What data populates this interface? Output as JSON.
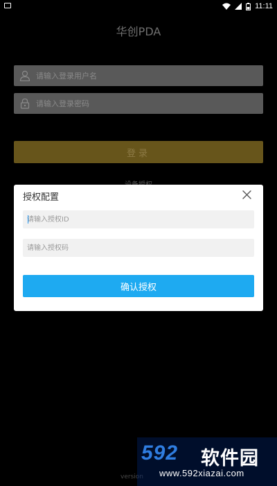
{
  "status_bar": {
    "time": "11:11",
    "icons": [
      "keyboard-icon",
      "wifi-icon",
      "signal-icon",
      "battery-icon"
    ]
  },
  "app": {
    "title": "华创PDA",
    "username": {
      "placeholder": "请输入登录用户名",
      "icon": "user-icon"
    },
    "password": {
      "placeholder": "请输入登录密码",
      "icon": "lock-icon"
    },
    "login_label": "登录",
    "device_auth_label": "设备授权",
    "version_label": "version"
  },
  "dialog": {
    "title": "授权配置",
    "close_icon": "close-icon",
    "auth_id": {
      "placeholder": "请输入授权ID",
      "value": ""
    },
    "auth_code": {
      "placeholder": "请输入授权码",
      "value": ""
    },
    "confirm_label": "确认授权"
  },
  "watermark": {
    "logo_number": "592",
    "logo_text": "软件园",
    "url": "www.592xiazai.com"
  },
  "colors": {
    "background": "#000000",
    "field_bg": "#595959",
    "login_button": "#67551b",
    "dialog_bg": "#ffffff",
    "confirm_button": "#1eaaf1",
    "cursor": "#2196f3"
  }
}
